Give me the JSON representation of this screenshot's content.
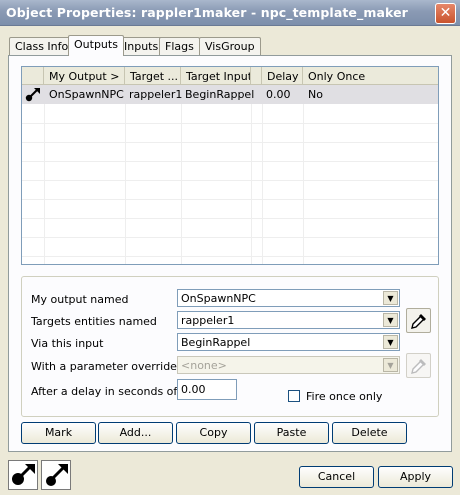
{
  "window": {
    "title": "Object Properties: rappler1maker - npc_template_maker"
  },
  "tabs": [
    "Class Info",
    "Outputs",
    "Inputs",
    "Flags",
    "VisGroup"
  ],
  "list": {
    "columns": [
      "My Output >",
      "Target ...",
      "Target Input",
      "Delay",
      "Only Once"
    ],
    "rows": [
      {
        "output": "OnSpawnNPC",
        "target": "rappeler1",
        "input": "BeginRappel",
        "delay": "0.00",
        "once": "No"
      }
    ]
  },
  "form": {
    "output_label": "My output named",
    "output_value": "OnSpawnNPC",
    "targets_label": "Targets entities named",
    "targets_value": "rappeler1",
    "input_label": "Via this input",
    "input_value": "BeginRappel",
    "param_label": "With a parameter override of",
    "param_value": "<none>",
    "delay_label": "After a delay in seconds of",
    "delay_value": "0.00",
    "fire_once_label": "Fire once only"
  },
  "actions": {
    "mark": "Mark",
    "add": "Add...",
    "copy": "Copy",
    "paste": "Paste",
    "delete": "Delete"
  },
  "footer": {
    "cancel": "Cancel",
    "apply": "Apply"
  }
}
